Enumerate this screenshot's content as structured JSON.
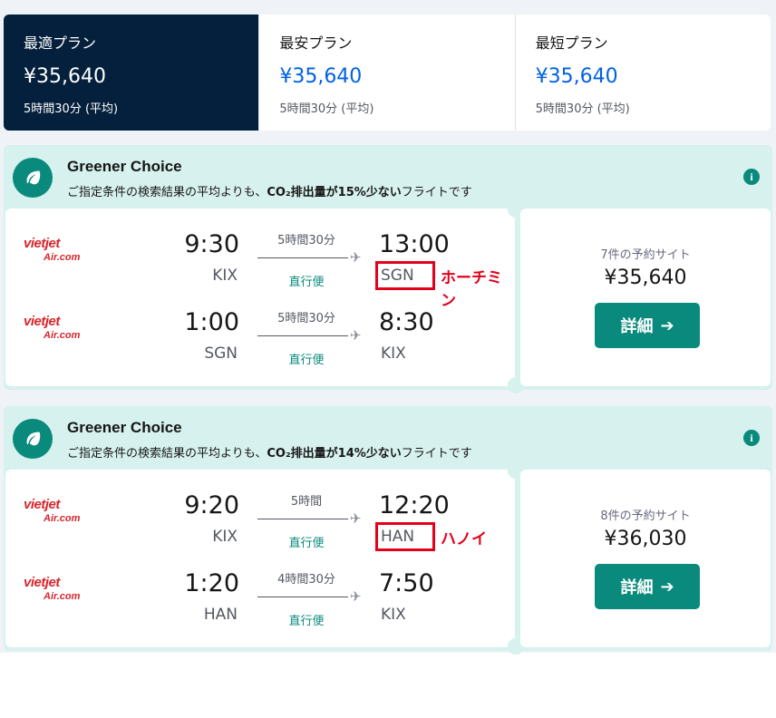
{
  "tabs": [
    {
      "title": "最適プラン",
      "price": "¥35,640",
      "sub": "5時間30分 (平均)"
    },
    {
      "title": "最安プラン",
      "price": "¥35,640",
      "sub": "5時間30分 (平均)"
    },
    {
      "title": "最短プラン",
      "price": "¥35,640",
      "sub": "5時間30分 (平均)"
    }
  ],
  "results": [
    {
      "greener_title": "Greener Choice",
      "greener_desc_pre": "ご指定条件の検索結果の平均よりも、",
      "greener_desc_bold": "CO₂排出量が15%少ない",
      "greener_desc_post": "フライトです",
      "legs": [
        {
          "airline_line1": "vietjet",
          "airline_line2": "Air",
          "airline_suffix": ".com",
          "dep_time": "9:30",
          "dep_code": "KIX",
          "duration": "5時間30分",
          "stops": "直行便",
          "arr_time": "13:00",
          "arr_code": "SGN",
          "annotation": "ホーチミン"
        },
        {
          "airline_line1": "vietjet",
          "airline_line2": "Air",
          "airline_suffix": ".com",
          "dep_time": "1:00",
          "dep_code": "SGN",
          "duration": "5時間30分",
          "stops": "直行便",
          "arr_time": "8:30",
          "arr_code": "KIX"
        }
      ],
      "sites": "7件の予約サイト",
      "price": "¥35,640",
      "button": "詳細"
    },
    {
      "greener_title": "Greener Choice",
      "greener_desc_pre": "ご指定条件の検索結果の平均よりも、",
      "greener_desc_bold": "CO₂排出量が14%少ない",
      "greener_desc_post": "フライトです",
      "legs": [
        {
          "airline_line1": "vietjet",
          "airline_line2": "Air",
          "airline_suffix": ".com",
          "dep_time": "9:20",
          "dep_code": "KIX",
          "duration": "5時間",
          "stops": "直行便",
          "arr_time": "12:20",
          "arr_code": "HAN",
          "annotation": "ハノイ"
        },
        {
          "airline_line1": "vietjet",
          "airline_line2": "Air",
          "airline_suffix": ".com",
          "dep_time": "1:20",
          "dep_code": "HAN",
          "duration": "4時間30分",
          "stops": "直行便",
          "arr_time": "7:50",
          "arr_code": "KIX"
        }
      ],
      "sites": "8件の予約サイト",
      "price": "¥36,030",
      "button": "詳細"
    }
  ],
  "icons": {
    "leaf": "leaf-icon",
    "info": "info-icon",
    "plane": "plane-icon",
    "arrow": "arrow-right-icon"
  },
  "colors": {
    "navy": "#05203c",
    "teal": "#0a8a7c",
    "mint": "#d6f1ee",
    "blue": "#0062e3",
    "annotation_red": "#e3001b",
    "vietjet_red": "#d7262d"
  }
}
